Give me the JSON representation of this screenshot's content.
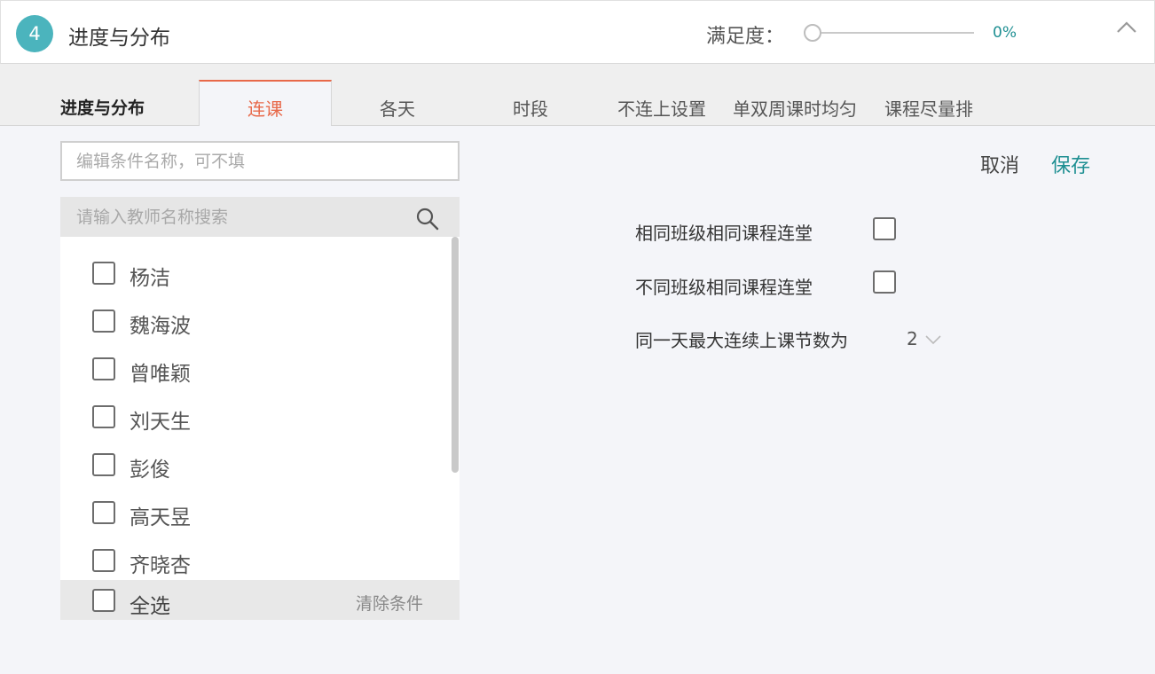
{
  "header": {
    "step_number": "4",
    "title": "进度与分布",
    "satisfaction_label": "满足度：",
    "satisfaction_value": "0%",
    "satisfaction_level": 0
  },
  "tabs": {
    "heading": "进度与分布",
    "items": [
      {
        "label": "连课",
        "active": true
      },
      {
        "label": "各天",
        "active": false
      },
      {
        "label": "时段",
        "active": false
      },
      {
        "label": "不连上设置",
        "active": false
      },
      {
        "label": "单双周课时均匀",
        "active": false
      },
      {
        "label": "课程尽量排",
        "active": false
      }
    ]
  },
  "form": {
    "name_placeholder": "编辑条件名称，可不填",
    "name_value": "",
    "cancel_label": "取消",
    "save_label": "保存"
  },
  "teacher_search": {
    "placeholder": "请输入教师名称搜索",
    "value": ""
  },
  "teachers": [
    "杨洁",
    "魏海波",
    "曾唯颖",
    "刘天生",
    "彭俊",
    "高天昱",
    "齐晓杏"
  ],
  "list_footer": {
    "select_all_label": "全选",
    "clear_label": "清除条件"
  },
  "options": {
    "same_class_label": "相同班级相同课程连堂",
    "same_class_checked": false,
    "diff_class_label": "不同班级相同课程连堂",
    "diff_class_checked": false,
    "max_consecutive_label": "同一天最大连续上课节数为",
    "max_consecutive_value": "2"
  },
  "colors": {
    "accent": "#1e8f92",
    "badge": "#4bb4bd",
    "active_tab": "#e8694a"
  }
}
